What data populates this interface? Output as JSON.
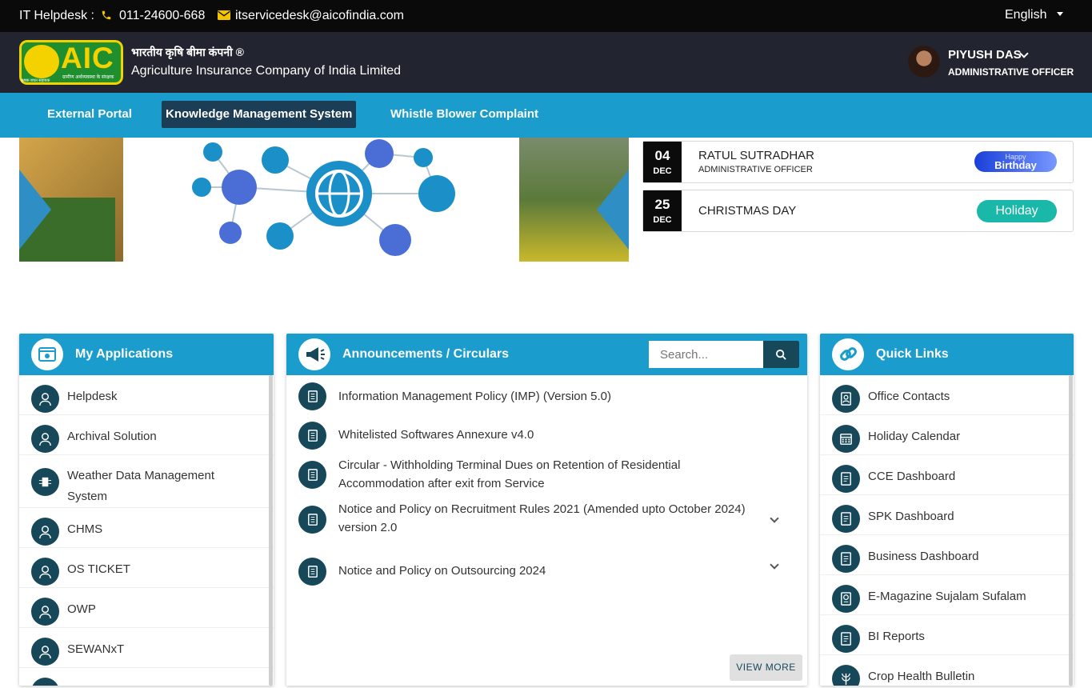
{
  "topbar": {
    "helpdesk_label": "IT Helpdesk :",
    "phone": "011-24600-668",
    "email": "itservicedesk@aicofindia.com",
    "language": "English"
  },
  "header": {
    "logo_text": "AIC",
    "logo_tagline": "ग्रामीण अर्थव्यवस्था के संरक्षक",
    "logo_tagline2": "कृषक बचत सहायक",
    "org_name_hindi": "भारतीय कृषि बीमा कंपनी ®",
    "org_name_english": "Agriculture Insurance Company of India Limited",
    "user_name": "PIYUSH DAS",
    "user_role": "ADMINISTRATIVE OFFICER"
  },
  "nav": {
    "items": [
      {
        "label": "External Portal"
      },
      {
        "label": "Knowledge Management System"
      },
      {
        "label": "Whistle Blower Complaint"
      }
    ]
  },
  "events": [
    {
      "day": "04",
      "month": "DEC",
      "name": "RATUL SUTRADHAR",
      "role": "ADMINISTRATIVE OFFICER",
      "badge_small": "Happy",
      "badge_large": "Birthday"
    },
    {
      "day": "25",
      "month": "DEC",
      "name": "CHRISTMAS DAY",
      "badge": "Holiday"
    }
  ],
  "my_applications": {
    "title": "My Applications",
    "items": [
      {
        "label": "Helpdesk"
      },
      {
        "label": "Archival Solution"
      },
      {
        "label": "Weather Data Management System"
      },
      {
        "label": "CHMS"
      },
      {
        "label": "OS TICKET"
      },
      {
        "label": "OWP"
      },
      {
        "label": "SEWANxT"
      }
    ]
  },
  "announcements": {
    "title": "Announcements / Circulars",
    "search_placeholder": "Search...",
    "items": [
      {
        "label": "Information Management Policy (IMP) (Version 5.0)"
      },
      {
        "label": "Whitelisted Softwares Annexure v4.0"
      },
      {
        "label": "Circular - Withholding Terminal Dues on Retention of Residential Accommodation after exit from Service"
      },
      {
        "label": "Notice and Policy on Recruitment Rules 2021 (Amended upto October 2024) version 2.0"
      },
      {
        "label": "Notice and Policy on Outsourcing 2024"
      }
    ],
    "view_more": "VIEW MORE"
  },
  "quick_links": {
    "title": "Quick Links",
    "items": [
      {
        "label": "Office Contacts",
        "icon": "contacts-icon"
      },
      {
        "label": "Holiday Calendar",
        "icon": "calendar-icon"
      },
      {
        "label": "CCE Dashboard",
        "icon": "checklist-icon"
      },
      {
        "label": "SPK Dashboard",
        "icon": "checklist-icon"
      },
      {
        "label": "Business Dashboard",
        "icon": "checklist-icon"
      },
      {
        "label": "E-Magazine Sujalam Sufalam",
        "icon": "magazine-icon"
      },
      {
        "label": "BI Reports",
        "icon": "checklist-icon"
      },
      {
        "label": "Crop Health Bulletin",
        "icon": "crop-icon"
      }
    ]
  },
  "colors": {
    "nav_blue": "#1a9ccc",
    "dark_teal": "#17485a",
    "header_dark": "#222530"
  }
}
